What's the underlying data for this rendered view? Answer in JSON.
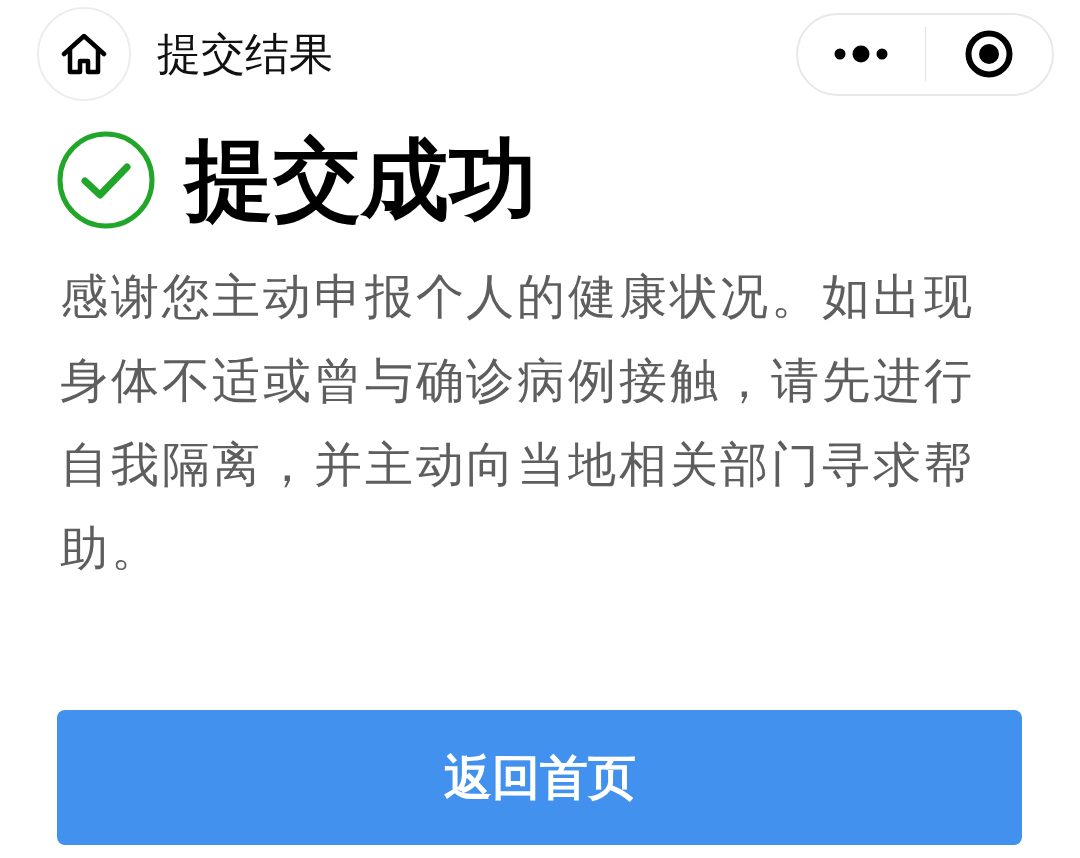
{
  "nav_bar": {
    "title": "提交结果"
  },
  "result": {
    "kind": "success",
    "title": "提交成功",
    "message": "感谢您主动申报个人的健康状况。如出现身体不适或曾与确诊病例接触，请先进行自我隔离，并主动向当地相关部门寻求帮助。"
  },
  "buttons": [
    {
      "label": "返回首页"
    }
  ]
}
